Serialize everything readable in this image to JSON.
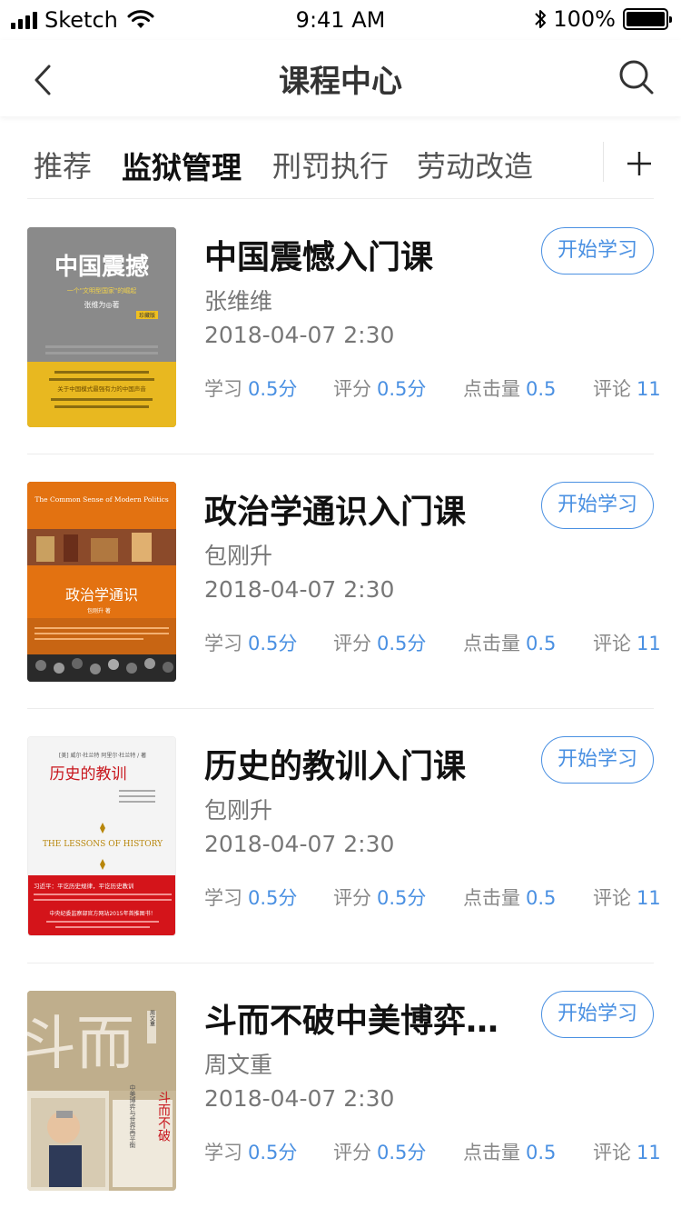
{
  "status_bar": {
    "carrier": "Sketch",
    "time": "9:41 AM",
    "battery_pct": "100%"
  },
  "nav": {
    "title": "课程中心",
    "back_icon": "chevron-left-icon",
    "search_icon": "search-icon"
  },
  "tabs": [
    {
      "label": "推荐"
    },
    {
      "label": "监狱管理",
      "active": true
    },
    {
      "label": "刑罚执行"
    },
    {
      "label": "劳动改造"
    }
  ],
  "stat_labels": {
    "study": "学习",
    "rating": "评分",
    "clicks": "点击量",
    "comments": "评论"
  },
  "courses": [
    {
      "title": "中国震憾入门课",
      "author": "张维维",
      "date": "2018-04-07 2:30",
      "button": "开始学习",
      "study": "0.5分",
      "rating": "0.5分",
      "clicks": "0.5",
      "comments": "11",
      "cover": {
        "title": "中国震撼",
        "subtitle": "一个\"文明型国家\"的崛起",
        "author": "张维为◎著",
        "badge": "珍藏版",
        "tagline": "关于中国模式最强有力的中国声音",
        "top_color": "#8c8c8c",
        "bottom_color": "#e8b820"
      }
    },
    {
      "title": "政治学通识入门课",
      "author": "包刚升",
      "date": "2018-04-07 2:30",
      "button": "开始学习",
      "study": "0.5分",
      "rating": "0.5分",
      "clicks": "0.5",
      "comments": "11",
      "cover": {
        "en_title": "The Common Sense of Modern Politics",
        "title": "政治学通识",
        "author": "包刚升 著",
        "top_color": "#e37211"
      }
    },
    {
      "title": "历史的教训入门课",
      "author": "包刚升",
      "date": "2018-04-07 2:30",
      "button": "开始学习",
      "study": "0.5分",
      "rating": "0.5分",
      "clicks": "0.5",
      "comments": "11",
      "cover": {
        "author_line": "[美] 威尔·杜兰特 阿里尔·杜兰特 / 著",
        "title": "历史的教训",
        "en_title": "THE LESSONS OF HISTORY",
        "band_text": "习近平：平讫历史规律，平讫历史教训",
        "footer": "中央纪委监察部官方网站2015年首推图书！",
        "band_color": "#d4141a"
      }
    },
    {
      "title": "斗而不破中美博弈…",
      "author": "周文重",
      "date": "2018-04-07 2:30",
      "button": "开始学习",
      "study": "0.5分",
      "rating": "0.5分",
      "clicks": "0.5",
      "comments": "11",
      "cover": {
        "big_chars": "斗而",
        "title": "斗而不破",
        "subtitle": "中美博弈与世界再平衡",
        "author": "周文重",
        "bg_color": "#c8b898"
      }
    }
  ]
}
